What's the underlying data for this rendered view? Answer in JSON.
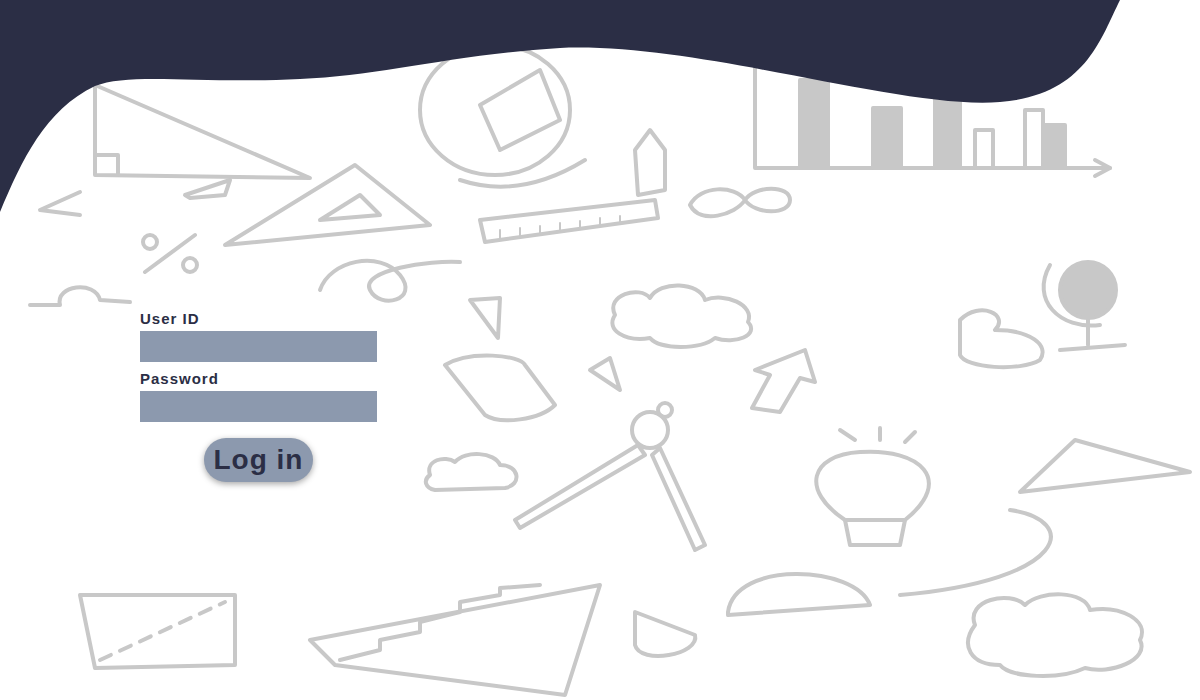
{
  "form": {
    "fields": [
      {
        "label": "User ID",
        "kind": "text"
      },
      {
        "label": "Password",
        "kind": "password"
      }
    ],
    "button": {
      "label": "Log in"
    }
  }
}
